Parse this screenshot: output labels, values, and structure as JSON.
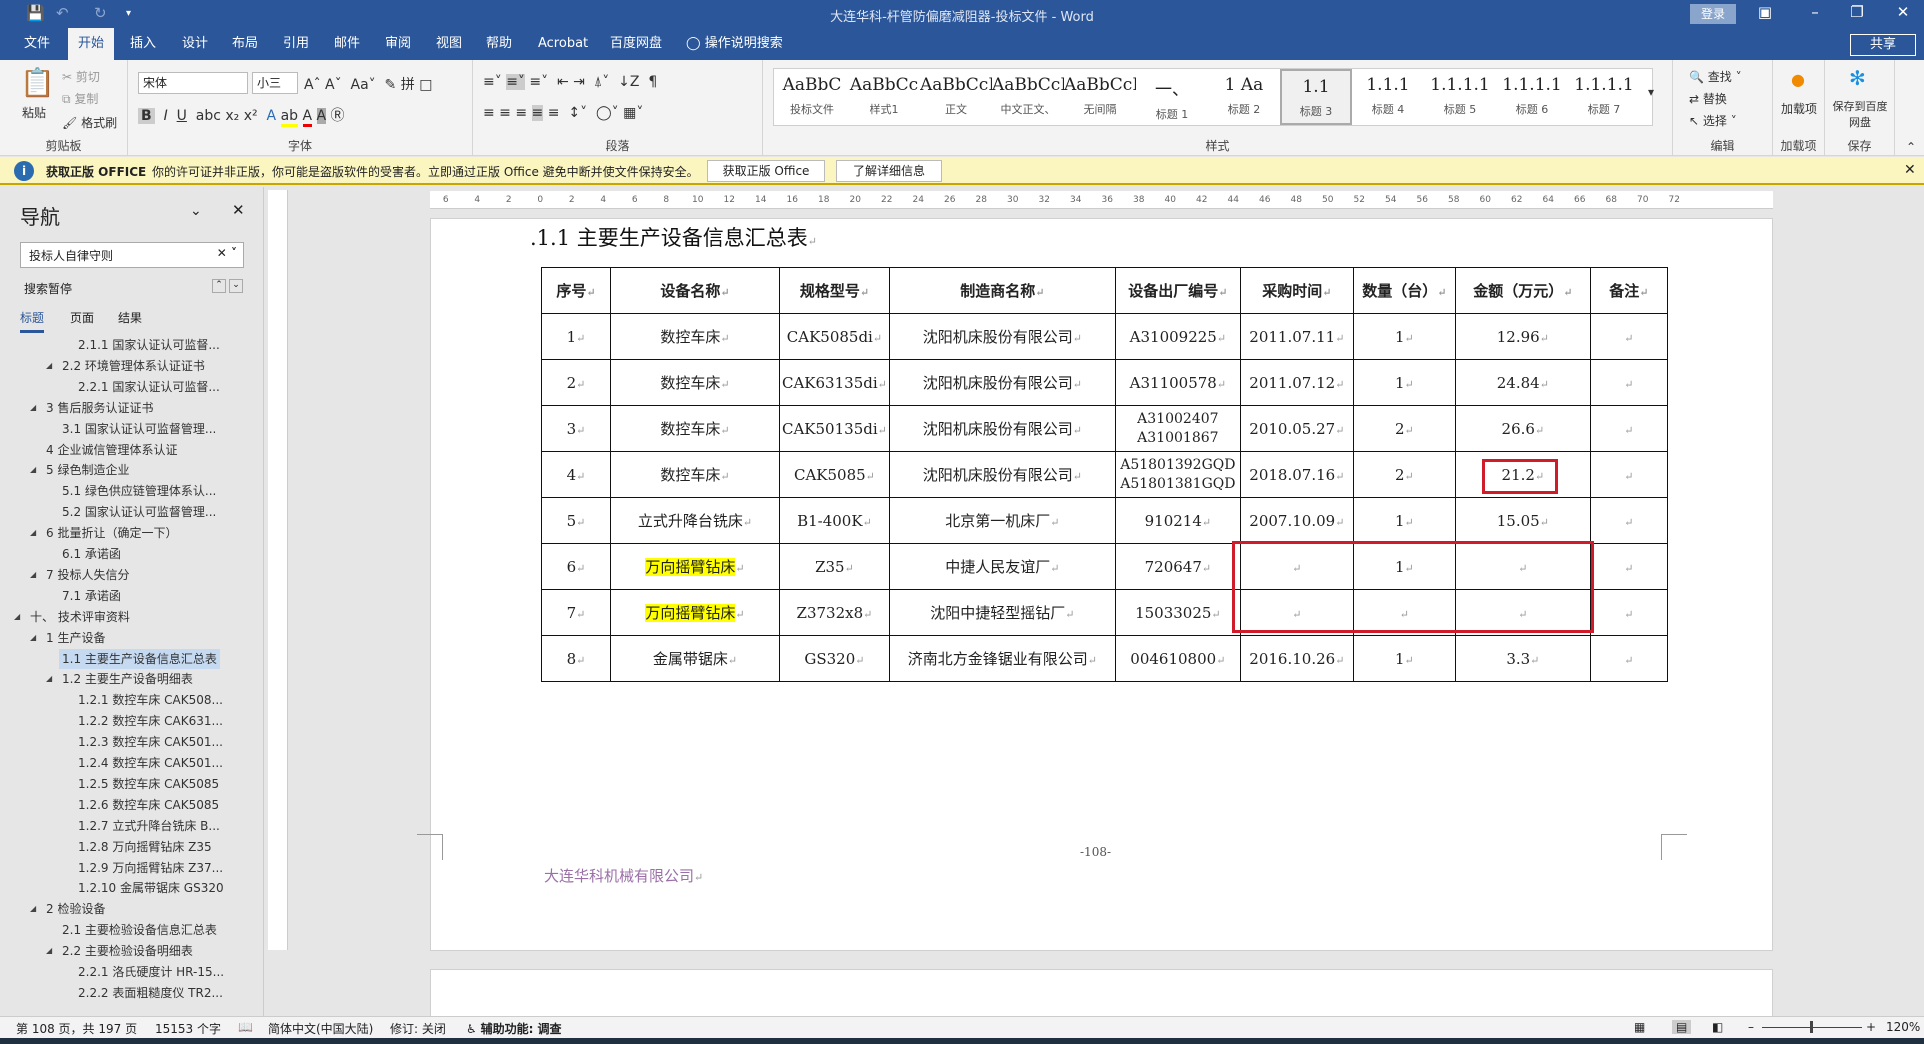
{
  "window": {
    "title": "大连华科-杆管防偏磨减阻器-投标文件  -  Word",
    "login": "登录",
    "share": "共享"
  },
  "tabs": [
    "文件",
    "开始",
    "插入",
    "设计",
    "布局",
    "引用",
    "邮件",
    "审阅",
    "视图",
    "帮助",
    "Acrobat",
    "百度网盘",
    "操作说明搜索"
  ],
  "ribbon": {
    "clipboard": {
      "paste": "粘贴",
      "cut": "剪切",
      "copy": "复制",
      "format_painter": "格式刷",
      "label": "剪贴板"
    },
    "font": {
      "name": "宋体",
      "size": "小三",
      "label": "字体"
    },
    "paragraph": {
      "label": "段落"
    },
    "styles": {
      "label": "样式",
      "items": [
        {
          "preview": "AaBbC",
          "name": "投标文件"
        },
        {
          "preview": "AaBbCc",
          "name": "样式1"
        },
        {
          "preview": "AaBbCcDdI",
          "name": "正文"
        },
        {
          "preview": "AaBbCcDc",
          "name": "中文正文、"
        },
        {
          "preview": "AaBbCcDdI",
          "name": "无间隔"
        },
        {
          "preview": "一、",
          "name": "标题 1"
        },
        {
          "preview": "1  Aa",
          "name": "标题 2"
        },
        {
          "preview": "1.1",
          "name": "标题 3"
        },
        {
          "preview": "1.1.1",
          "name": "标题 4"
        },
        {
          "preview": "1.1.1.1",
          "name": "标题 5"
        },
        {
          "preview": "1.1.1.1",
          "name": "标题 6"
        },
        {
          "preview": "1.1.1.1",
          "name": "标题 7"
        }
      ]
    },
    "editing": {
      "find": "查找",
      "replace": "替换",
      "select": "选择",
      "label": "编辑"
    },
    "addins": {
      "button": "加载项",
      "label": "加载项"
    },
    "save": {
      "button": "保存到百度网盘",
      "label": "保存"
    }
  },
  "message_bar": {
    "title": "获取正版 OFFICE",
    "text": "你的许可证并非正版，你可能是盗版软件的受害者。立即通过正版 Office 避免中断并使文件保持安全。",
    "btn1": "获取正版 Office",
    "btn2": "了解详细信息"
  },
  "nav": {
    "title": "导航",
    "search_value": "投标人自律守则",
    "status": "搜索暂停",
    "tabs": [
      "标题",
      "页面",
      "结果"
    ],
    "items": [
      {
        "t": "2.1.1 国家认证认可监督...",
        "l": 3,
        "c": false
      },
      {
        "t": "2.2 环境管理体系认证证书",
        "l": 2,
        "c": true
      },
      {
        "t": "2.2.1 国家认证认可监督...",
        "l": 3,
        "c": false
      },
      {
        "t": "3 售后服务认证证书",
        "l": 1,
        "c": true
      },
      {
        "t": "3.1 国家认证认可监督管理...",
        "l": 2,
        "c": false
      },
      {
        "t": "4 企业诚信管理体系认证",
        "l": 1,
        "c": false
      },
      {
        "t": "5 绿色制造企业",
        "l": 1,
        "c": true
      },
      {
        "t": "5.1 绿色供应链管理体系认...",
        "l": 2,
        "c": false
      },
      {
        "t": "5.2 国家认证认可监督管理...",
        "l": 2,
        "c": false
      },
      {
        "t": "6 批量折让（确定一下）",
        "l": 1,
        "c": true
      },
      {
        "t": "6.1 承诺函",
        "l": 2,
        "c": false
      },
      {
        "t": "7 投标人失信分",
        "l": 1,
        "c": true
      },
      {
        "t": "7.1 承诺函",
        "l": 2,
        "c": false
      },
      {
        "t": "十、 技术评审资料",
        "l": 0,
        "c": true
      },
      {
        "t": "1 生产设备",
        "l": 1,
        "c": true
      },
      {
        "t": "1.1 主要生产设备信息汇总表",
        "l": 2,
        "c": false,
        "hl": true
      },
      {
        "t": "1.2 主要生产设备明细表",
        "l": 2,
        "c": true
      },
      {
        "t": "1.2.1 数控车床 CAK508...",
        "l": 3,
        "c": false
      },
      {
        "t": "1.2.2 数控车床 CAK631...",
        "l": 3,
        "c": false
      },
      {
        "t": "1.2.3 数控车床 CAK501...",
        "l": 3,
        "c": false
      },
      {
        "t": "1.2.4 数控车床 CAK501...",
        "l": 3,
        "c": false
      },
      {
        "t": "1.2.5 数控车床 CAK5085",
        "l": 3,
        "c": false
      },
      {
        "t": "1.2.6 数控车床 CAK5085",
        "l": 3,
        "c": false
      },
      {
        "t": "1.2.7 立式升降台铣床 B...",
        "l": 3,
        "c": false
      },
      {
        "t": "1.2.8 万向摇臂钻床 Z35",
        "l": 3,
        "c": false
      },
      {
        "t": "1.2.9 万向摇臂钻床 Z37...",
        "l": 3,
        "c": false
      },
      {
        "t": "1.2.10 金属带锯床 GS320",
        "l": 3,
        "c": false
      },
      {
        "t": "2 检验设备",
        "l": 1,
        "c": true
      },
      {
        "t": "2.1 主要检验设备信息汇总表",
        "l": 2,
        "c": false
      },
      {
        "t": "2.2 主要检验设备明细表",
        "l": 2,
        "c": true
      },
      {
        "t": "2.2.1 洛氏硬度计 HR-15...",
        "l": 3,
        "c": false
      },
      {
        "t": "2.2.2 表面粗糙度仪 TR2...",
        "l": 3,
        "c": false
      }
    ]
  },
  "document": {
    "heading": ".1.1   主要生产设备信息汇总表",
    "table": {
      "headers": [
        "序号",
        "设备名称",
        "规格型号",
        "制造商名称",
        "设备出厂编号",
        "采购时间",
        "数量（台）",
        "金额（万元）",
        "备注"
      ],
      "rows": [
        [
          "1",
          "数控车床",
          "CAK5085di",
          "沈阳机床股份有限公司",
          "A31009225",
          "2011.07.11",
          "1",
          "12.96",
          ""
        ],
        [
          "2",
          "数控车床",
          "CAK63135di",
          "沈阳机床股份有限公司",
          "A31100578",
          "2011.07.12",
          "1",
          "24.84",
          ""
        ],
        [
          "3",
          "数控车床",
          "CAK50135di",
          "沈阳机床股份有限公司",
          "A31002407\nA31001867",
          "2010.05.27",
          "2",
          "26.6",
          ""
        ],
        [
          "4",
          "数控车床",
          "CAK5085",
          "沈阳机床股份有限公司",
          "A51801392GQD\nA51801381GQD",
          "2018.07.16",
          "2",
          "21.2",
          ""
        ],
        [
          "5",
          "立式升降台铣床",
          "B1-400K",
          "北京第一机床厂",
          "910214",
          "2007.10.09",
          "1",
          "15.05",
          ""
        ],
        [
          "6",
          "万向摇臂钻床",
          "Z35",
          "中捷人民友谊厂",
          "720647",
          "",
          "1",
          "",
          ""
        ],
        [
          "7",
          "万向摇臂钻床",
          "Z3732x8",
          "沈阳中捷轻型摇钻厂",
          "15033025",
          "",
          "",
          "",
          ""
        ],
        [
          "8",
          "金属带锯床",
          "GS320",
          "济南北方金锋锯业有限公司",
          "004610800",
          "2016.10.26",
          "1",
          "3.3",
          ""
        ]
      ]
    },
    "page_number": "-108-",
    "footer": "大连华科机械有限公司"
  },
  "status": {
    "page": "第 108 页，共 197 页",
    "words": "15153 个字",
    "language": "简体中文(中国大陆)",
    "track": "修订: 关闭",
    "accessibility": "辅助功能: 调查",
    "zoom": "120%"
  },
  "colors": {
    "brand": "#2b579a",
    "highlight": "#ffff00",
    "annotation": "#d01c2a"
  }
}
